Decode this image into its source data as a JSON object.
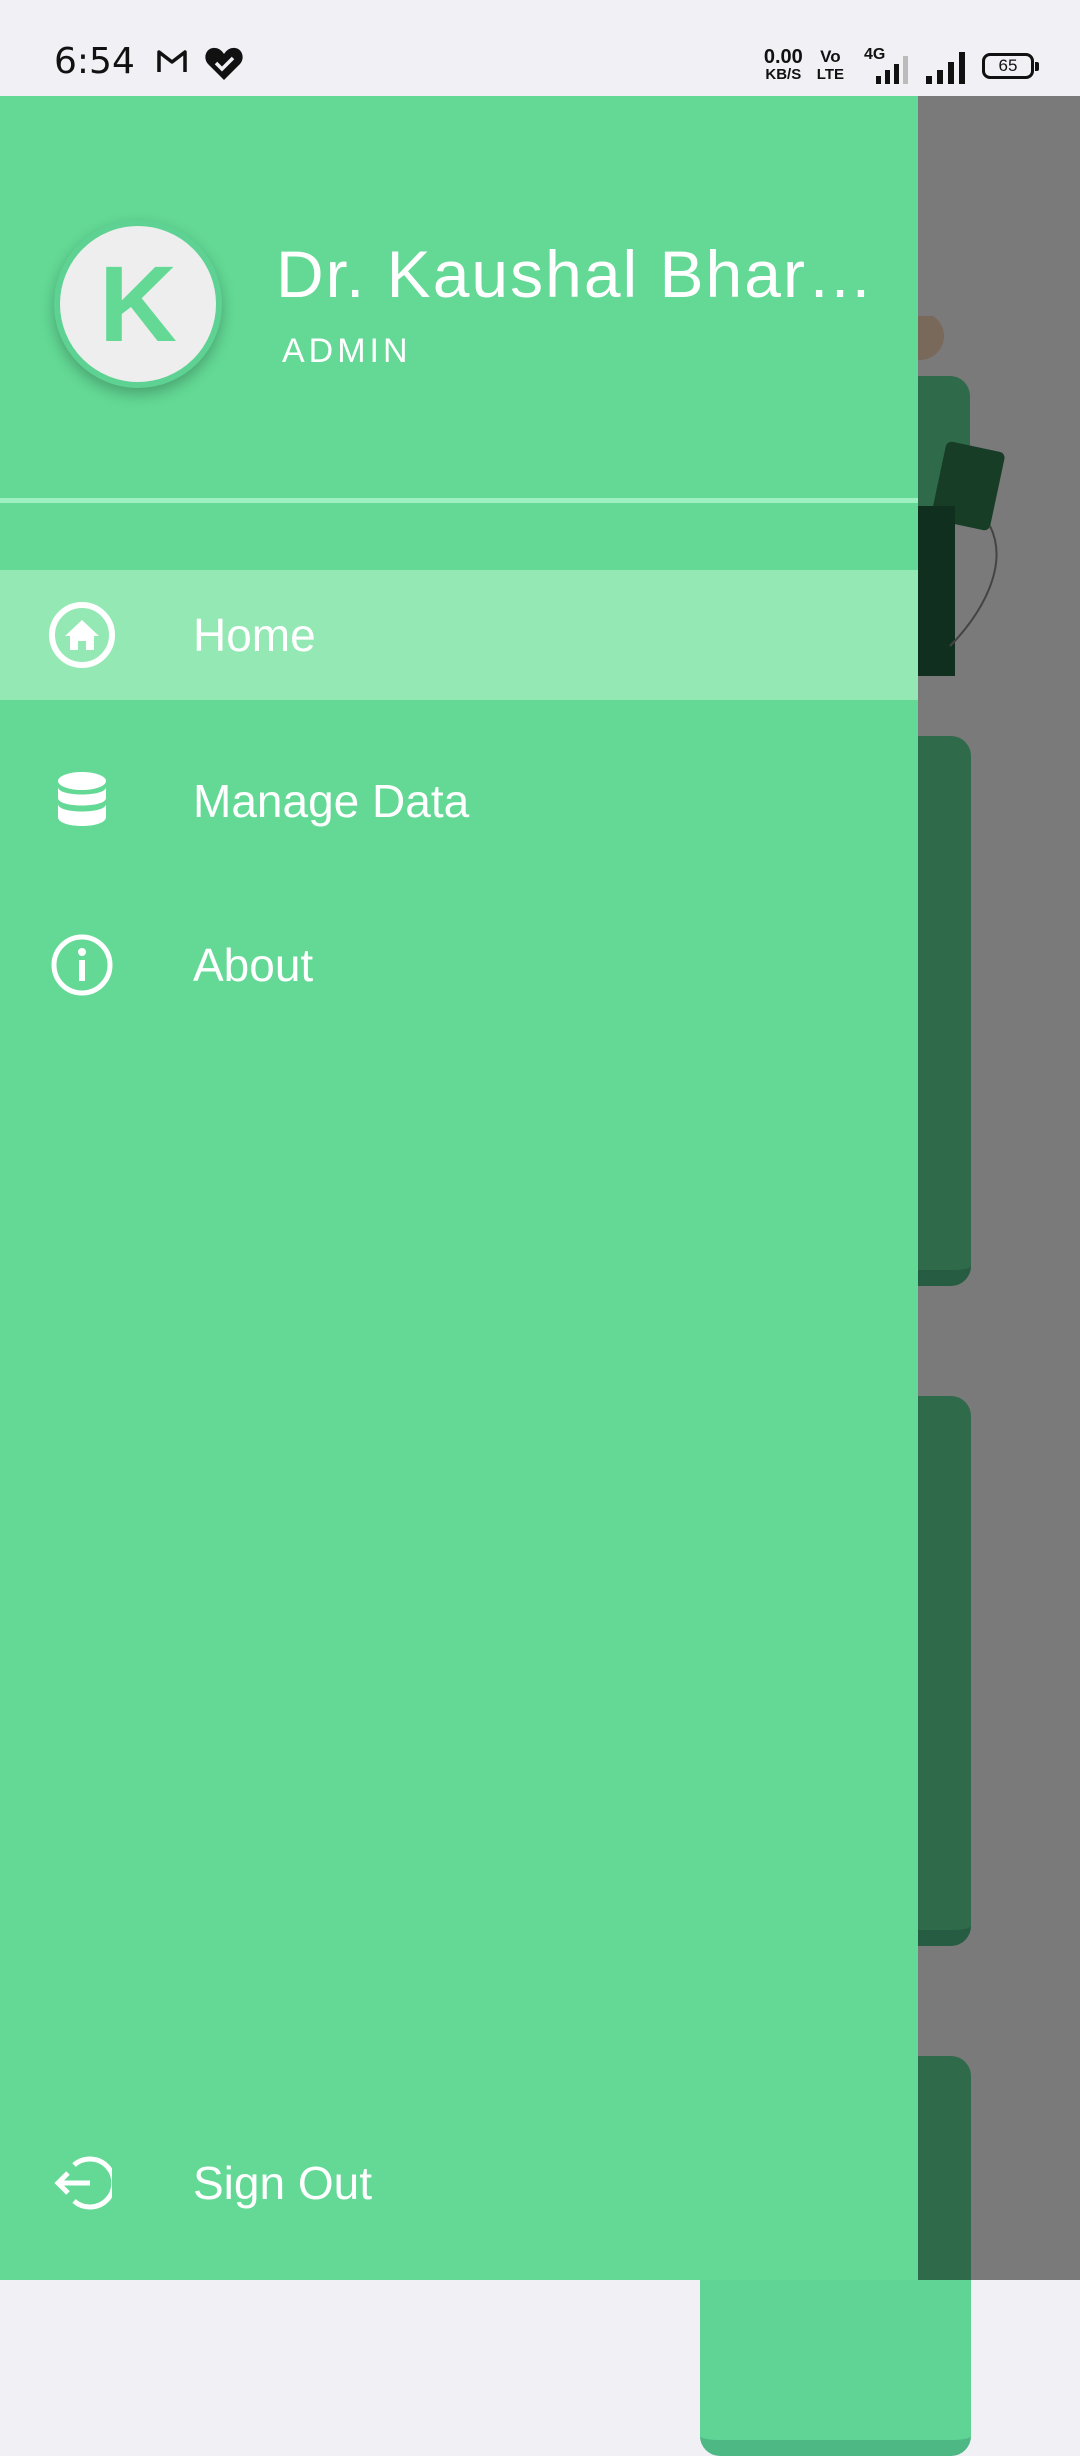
{
  "status_bar": {
    "time": "6:54",
    "net_speed": "0.00",
    "net_unit": "KB/S",
    "volte_top": "Vo",
    "volte_bottom": "LTE",
    "network_type": "4G",
    "battery": "65",
    "icons": [
      "gmail-icon",
      "heart-check-icon",
      "signal-icon",
      "battery-icon"
    ]
  },
  "drawer": {
    "avatar_letter": "K",
    "user_name": "Dr. Kaushal Bharadwaj",
    "user_role": "ADMIN",
    "menu": [
      {
        "label": "Home",
        "icon": "home-icon",
        "active": true
      },
      {
        "label": "Manage Data",
        "icon": "database-icon",
        "active": false
      },
      {
        "label": "About",
        "icon": "info-icon",
        "active": false
      }
    ],
    "sign_out": {
      "label": "Sign Out",
      "icon": "sign-out-icon"
    }
  },
  "colors": {
    "drawer_bg": "#63d995",
    "active_item_bg": "#93e8b4",
    "status_bar_bg": "#f1f0f5"
  }
}
